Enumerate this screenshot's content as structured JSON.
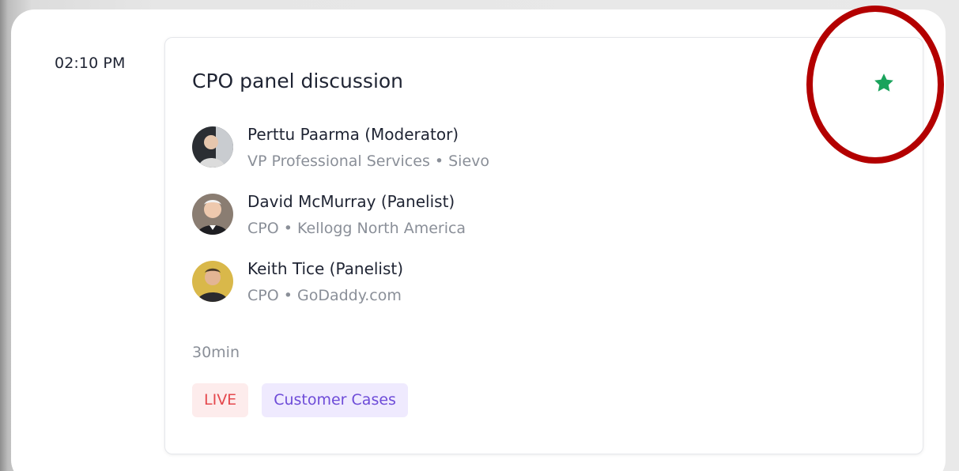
{
  "session": {
    "time": "02:10 PM",
    "title": "CPO panel discussion",
    "duration": "30min",
    "favorited": true,
    "favorite_icon": "star-icon",
    "speakers": [
      {
        "name": "Perttu Paarma (Moderator)",
        "role": "VP Professional Services • Sievo"
      },
      {
        "name": "David McMurray (Panelist)",
        "role": "CPO • Kellogg North America"
      },
      {
        "name": "Keith Tice (Panelist)",
        "role": "CPO • GoDaddy.com"
      }
    ],
    "tags": [
      {
        "label": "LIVE"
      },
      {
        "label": "Customer Cases"
      }
    ]
  },
  "colors": {
    "favorite_star": "#1aa35c",
    "live_tag_text": "#e5484d",
    "live_tag_bg": "#fdecec",
    "category_tag_text": "#6d4bd8",
    "category_tag_bg": "#efeafe",
    "highlight_circle": "#b30000"
  }
}
